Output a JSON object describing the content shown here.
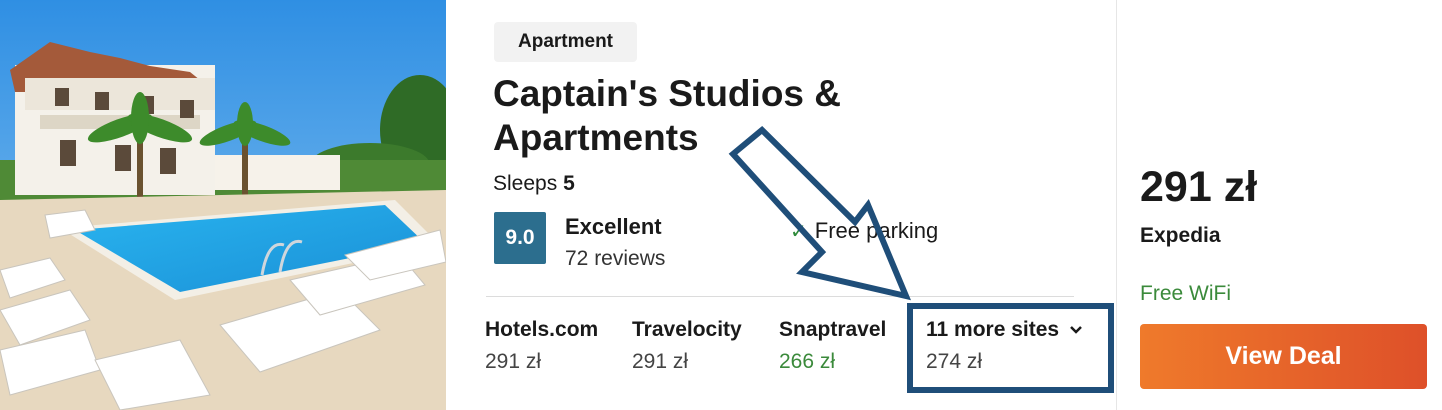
{
  "listing": {
    "type_badge": "Apartment",
    "title": "Captain's Studios & Apartments",
    "sleeps_label": "Sleeps",
    "sleeps_count": "5",
    "score": "9.0",
    "rating_word": "Excellent",
    "reviews": "72 reviews",
    "amenity": "Free parking",
    "amenity_icon": "check-icon"
  },
  "sites": [
    {
      "name": "Hotels.com",
      "price": "291 zł"
    },
    {
      "name": "Travelocity",
      "price": "291 zł"
    },
    {
      "name": "Snaptravel",
      "price": "266 zł"
    },
    {
      "name": "11 more sites",
      "price": "274 zł"
    }
  ],
  "deal": {
    "price": "291 zł",
    "provider": "Expedia",
    "perk": "Free WiFi",
    "button_label": "View Deal"
  },
  "colors": {
    "score_bg": "#2c6e8e",
    "green": "#3b8a3b",
    "button_start": "#ef7a2b",
    "button_end": "#de5029",
    "annotation": "#1f4e79"
  }
}
